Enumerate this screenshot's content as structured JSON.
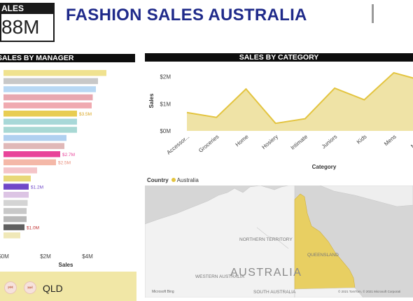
{
  "kpi": {
    "title": "ALES",
    "value": "88M"
  },
  "page_title": "FASHION SALES AUSTRALIA",
  "manager_panel": {
    "header": "SALES BY MANAGER",
    "xlabel": "Sales"
  },
  "category_panel": {
    "header": "SALES BY CATEGORY",
    "xlabel": "Category",
    "ylabel": "Sales"
  },
  "legend": {
    "label": "Country",
    "item": "Australia"
  },
  "map": {
    "region_label": "AUSTRALIA",
    "territory_label": "NORTHERN TERRITORY",
    "state_labels": [
      "WESTERN AUSTRALIA",
      "SOUTH AUSTRALIA",
      "QUEENSLAND"
    ],
    "attribution_left": "Microsoft Bing",
    "attribution_right": "© 2021 TomTom, © 2021 Microsoft Corporati"
  },
  "filter": {
    "state": "QLD",
    "prev_icon": "skip-back-icon",
    "next_icon": "skip-forward-icon"
  },
  "colors": {
    "accent": "#e3c43f",
    "title": "#1f2a8a",
    "header": "#0d0d0d",
    "filter_bg": "#f1e7a6"
  },
  "chart_data": [
    {
      "type": "bar",
      "orientation": "horizontal",
      "title": "SALES BY MANAGER",
      "xlabel": "Sales",
      "xlim": [
        0,
        5.0
      ],
      "x_ticks": [
        "$0M",
        "$2M",
        "$4M"
      ],
      "x_tick_values": [
        0,
        2,
        4
      ],
      "values": [
        4.9,
        4.5,
        4.4,
        4.25,
        4.2,
        3.5,
        3.5,
        3.5,
        3.0,
        2.9,
        2.7,
        2.5,
        1.6,
        1.3,
        1.2,
        1.2,
        1.15,
        1.1,
        1.1,
        1.0,
        0.8
      ],
      "colors": [
        "#f0e28f",
        "#c8c8c8",
        "#b8d8f4",
        "#e8a8b0",
        "#f0aab0",
        "#e8cd52",
        "#a8d8d8",
        "#a8d8d4",
        "#b0d0f0",
        "#e0b8b8",
        "#e8449a",
        "#f4b8a8",
        "#f4c4c8",
        "#e8d878",
        "#7048c8",
        "#dcc4e4",
        "#d4d4d4",
        "#c8c8c8",
        "#b8b8b8",
        "#606060",
        "#f0e8b8"
      ],
      "data_labels": [
        null,
        null,
        null,
        null,
        null,
        "$3.5M",
        null,
        null,
        null,
        null,
        "$2.7M",
        "$2.5M",
        null,
        null,
        "$1.2M",
        null,
        null,
        null,
        null,
        "$1.0M",
        null
      ],
      "label_colors": {
        "$3.5M": "#d9a520",
        "$2.7M": "#e8449a",
        "$2.5M": "#e88a78",
        "$1.2M": "#7048c8",
        "$1.0M": "#c03030"
      }
    },
    {
      "type": "area",
      "title": "SALES BY CATEGORY",
      "xlabel": "Category",
      "ylabel": "Sales",
      "ylim": [
        0,
        2.2
      ],
      "y_ticks": [
        "$0M",
        "$1M",
        "$2M"
      ],
      "y_tick_values": [
        0,
        1,
        2
      ],
      "categories": [
        "Accessor...",
        "Groceries",
        "Home",
        "Hosiery",
        "Intimate",
        "Juniors",
        "Kids",
        "Mens",
        "Misses"
      ],
      "values": [
        0.68,
        0.5,
        1.55,
        0.28,
        0.45,
        1.58,
        1.15,
        2.15,
        1.85
      ],
      "color": "#e3c43f",
      "fill": "#efe3a6"
    }
  ]
}
